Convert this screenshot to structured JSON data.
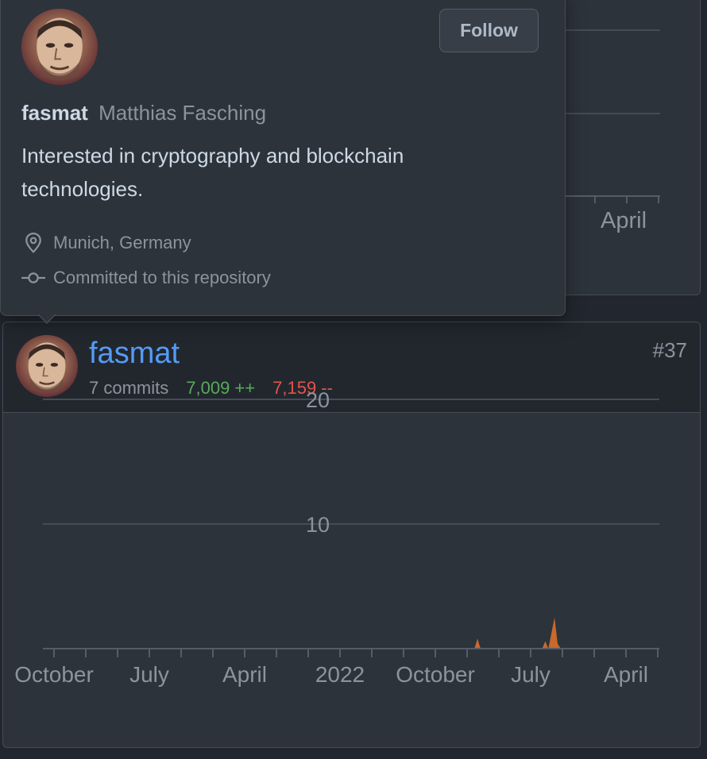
{
  "hovercard": {
    "follow_label": "Follow",
    "login": "fasmat",
    "full_name": "Matthias Fasching",
    "bio": "Interested in cryptography and blockchain technologies.",
    "location": "Munich, Germany",
    "relation": "Committed to this repository",
    "icons": [
      "location-pin-icon",
      "commit-icon"
    ]
  },
  "background_chart": {
    "x_tick_label": "April"
  },
  "contributor": {
    "username": "fasmat",
    "commits_label": "7 commits",
    "additions_label": "7,009 ++",
    "deletions_label": "7,159 --",
    "rank": "#37"
  },
  "colors": {
    "addition": "#57ab5a",
    "deletion": "#e5534b",
    "link": "#539bf5",
    "area": "#c9692b"
  },
  "chart_data": {
    "type": "area",
    "y_ticks": [
      10,
      20
    ],
    "y_tick_labels": [
      "10",
      "20"
    ],
    "x_tick_labels": [
      "October",
      "July",
      "April",
      "2022",
      "October",
      "July",
      "April"
    ],
    "series": [
      {
        "values": [
          {
            "x": 0.7,
            "y": 0
          },
          {
            "x": 0.705,
            "y": 0.8
          },
          {
            "x": 0.71,
            "y": 0
          },
          {
            "x": 0.81,
            "y": 0
          },
          {
            "x": 0.815,
            "y": 0.6
          },
          {
            "x": 0.82,
            "y": 0
          },
          {
            "x": 0.83,
            "y": 2.5
          },
          {
            "x": 0.835,
            "y": 0.4
          },
          {
            "x": 0.84,
            "y": 0
          }
        ]
      }
    ],
    "ylim": [
      0,
      20
    ],
    "grid": true
  }
}
